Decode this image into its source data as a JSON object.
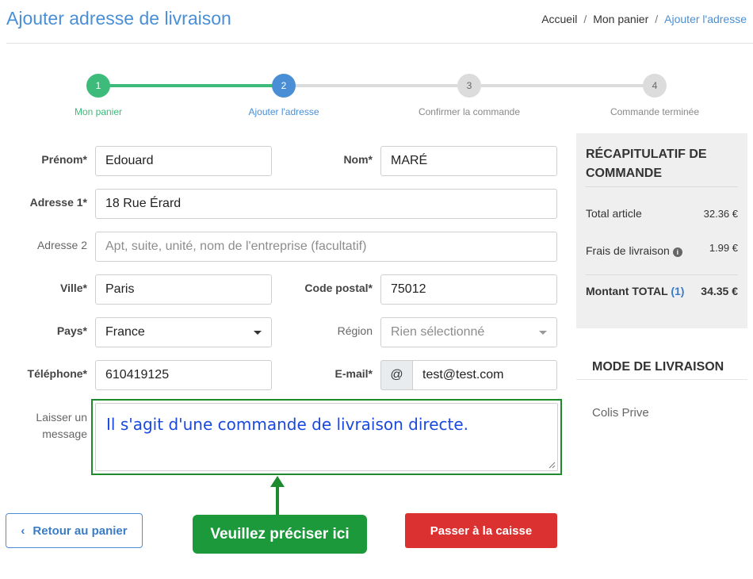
{
  "page": {
    "title": "Ajouter adresse de livraison"
  },
  "breadcrumb": {
    "items": [
      "Accueil",
      "Mon panier",
      "Ajouter l'adresse"
    ],
    "separator": "/"
  },
  "stepper": {
    "steps": [
      {
        "number": "1",
        "label": "Mon panier",
        "state": "done",
        "color": "#3dbb7a"
      },
      {
        "number": "2",
        "label": "Ajouter l'adresse",
        "state": "active",
        "color": "#4a8fd6"
      },
      {
        "number": "3",
        "label": "Confirmer la commande",
        "state": "pending",
        "color": "#d9d9d9"
      },
      {
        "number": "4",
        "label": "Commande terminée",
        "state": "pending",
        "color": "#d9d9d9"
      }
    ]
  },
  "form": {
    "prenom": {
      "label": "Prénom*",
      "value": "Edouard"
    },
    "nom": {
      "label": "Nom*",
      "value": "MARÉ"
    },
    "adresse1": {
      "label": "Adresse 1*",
      "value": "18 Rue Érard"
    },
    "adresse2": {
      "label": "Adresse 2",
      "placeholder": "Apt, suite, unité, nom de l'entreprise (facultatif)"
    },
    "ville": {
      "label": "Ville*",
      "value": "Paris"
    },
    "code_postal": {
      "label": "Code postal*",
      "value": "75012"
    },
    "pays": {
      "label": "Pays*",
      "value": "France"
    },
    "region": {
      "label": "Région",
      "placeholder": "Rien sélectionné"
    },
    "telephone": {
      "label": "Téléphone*",
      "value": "610419125"
    },
    "email": {
      "label": "E-mail*",
      "addon": "@",
      "value": "test@test.com"
    },
    "message": {
      "label_line1": "Laisser un",
      "label_line2": "message",
      "value": "Il s'agit d'une commande de livraison directe."
    }
  },
  "annotation": {
    "callout": "Veuillez préciser ici",
    "color": "#1c9a3b"
  },
  "actions": {
    "back_icon": "‹",
    "back_label": "Retour au panier",
    "checkout_label": "Passer à la caisse"
  },
  "summary": {
    "title": "RÉCAPITULATIF DE COMMANDE",
    "total_article_label": "Total article",
    "total_article_value": "32.36 €",
    "frais_label": "Frais de livraison",
    "frais_value": "1.99 €",
    "montant_label": "Montant TOTAL",
    "montant_count": "(1)",
    "montant_value": "34.35 €"
  },
  "delivery": {
    "title": "MODE DE LIVRAISON",
    "option": "Colis Prive"
  },
  "colors": {
    "accent": "#4a8fd6",
    "success": "#3dbb7a",
    "danger": "#dc3131"
  }
}
